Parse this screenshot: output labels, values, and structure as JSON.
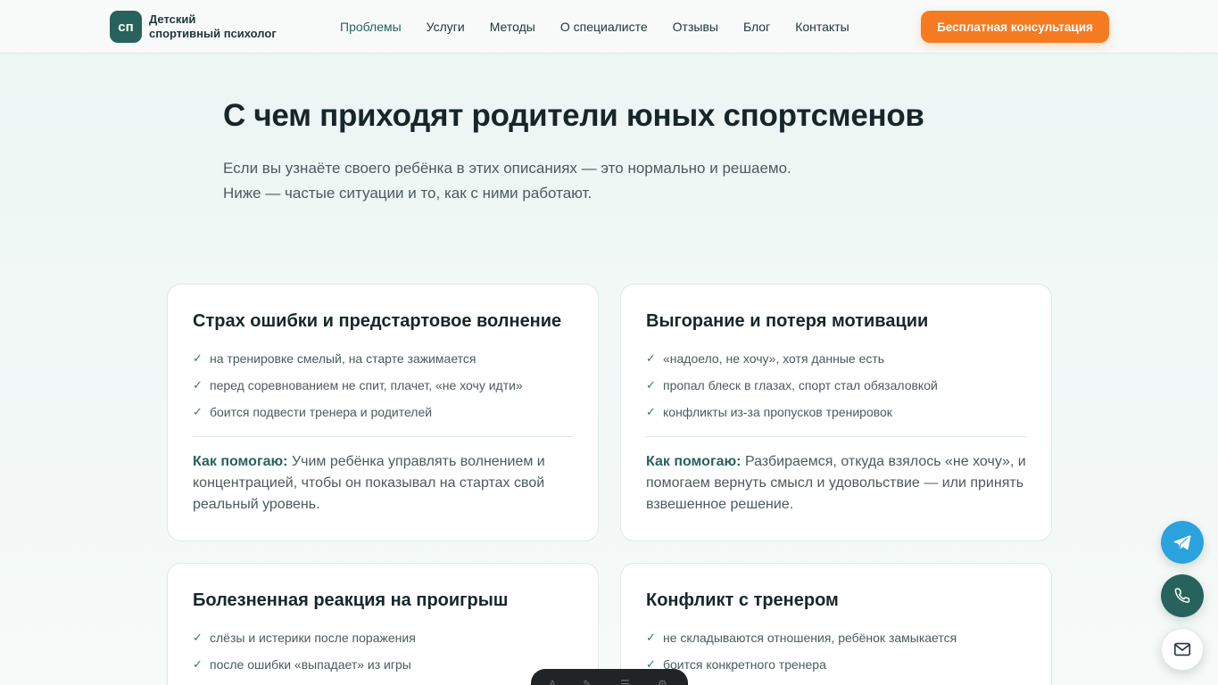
{
  "header": {
    "logo_badge": "сп",
    "logo_line1": "Детский",
    "logo_line2": "спортивный психолог",
    "nav": [
      "Проблемы",
      "Услуги",
      "Методы",
      "О специалисте",
      "Отзывы",
      "Блог",
      "Контакты"
    ],
    "active_nav": "Проблемы",
    "cta_label": "Бесплатная консультация",
    "accent_color": "#f47b22",
    "brand_color": "#27635c"
  },
  "hero": {
    "title": "С чем приходят родители юных спортсменов",
    "lead": "Если вы узнаёте своего ребёнка в этих описаниях — это нормально и решаемо. Ниже — частые ситуации и то, как с ними работают."
  },
  "cards": [
    {
      "title": "Страх ошибки и предстартовое волнение",
      "items": [
        "на тренировке смелый, на старте зажимается",
        "перед соревнованием не спит, плачет, «не хочу идти»",
        "боится подвести тренера и родителей"
      ],
      "help_label": "Как помогаю:",
      "help_text": " Учим ребёнка управлять волнением и концентрацией, чтобы он показывал на стартах свой реальный уровень."
    },
    {
      "title": "Выгорание и потеря мотивации",
      "items": [
        "«надоело, не хочу», хотя данные есть",
        "пропал блеск в глазах, спорт стал обязаловкой",
        "конфликты из-за пропусков тренировок"
      ],
      "help_label": "Как помогаю:",
      "help_text": " Разбираемся, откуда взялось «не хочу», и помогаем вернуть смысл и удовольствие — или принять взвешенное решение."
    },
    {
      "title": "Болезненная реакция на проигрыш",
      "items": [
        "слёзы и истерики после поражения",
        "после ошибки «выпадает» из игры"
      ]
    },
    {
      "title": "Конфликт с тренером",
      "items": [
        "не складываются отношения, ребёнок замыкается",
        "боится конкретного тренера"
      ]
    }
  ],
  "icons": {
    "check": "check-icon",
    "telegram": "telegram-icon",
    "phone": "phone-icon",
    "mail": "mail-icon"
  }
}
